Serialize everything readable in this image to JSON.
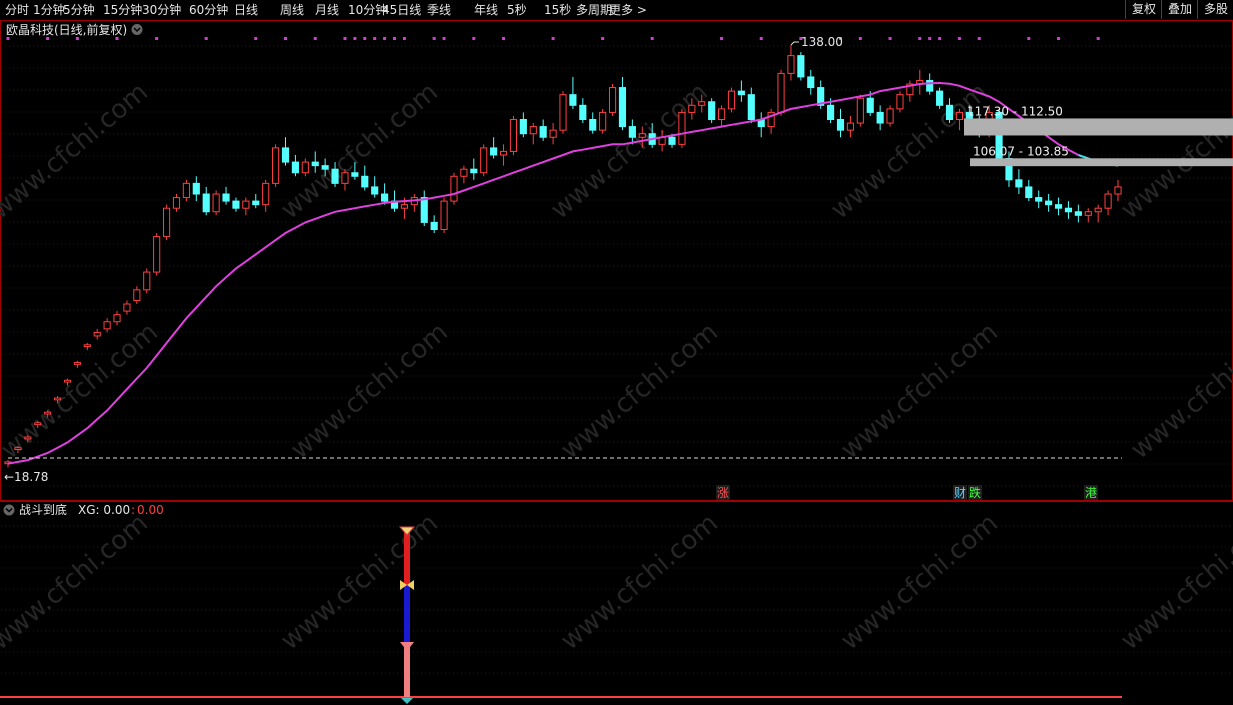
{
  "toolbar": {
    "periods": [
      "分时",
      "1分钟",
      "5分钟",
      "15分钟",
      "30分钟",
      "60分钟",
      "日线",
      "周线",
      "月线",
      "10分钟",
      "45日线",
      "季线",
      "年线",
      "5秒",
      "15秒",
      "多周期",
      "更多 >"
    ],
    "right_buttons": [
      "复权",
      "叠加",
      "多股"
    ]
  },
  "main_panel": {
    "title": "欧晶科技(日线,前复权)",
    "high_label": "138.00",
    "low_label": "18.78",
    "gap_label_1": "117.30 - 112.50",
    "gap_label_2": "106.07 - 103.85",
    "event_markers": [
      {
        "text": "涨",
        "color": "#ff5050"
      },
      {
        "text": "财",
        "color": "#5ad0ff"
      },
      {
        "text": "跌",
        "color": "#40ff40"
      },
      {
        "text": "港",
        "color": "#40ff40"
      }
    ]
  },
  "indicator_panel": {
    "name": "战斗到底",
    "xg_label": "XG: 0.00",
    "xg_value": "0.00"
  },
  "watermark": "www.cfchi.com",
  "colors": {
    "up": "#ff4040",
    "down": "#54ffff",
    "ma": "#e040e0",
    "ma_tail": "#40e0e8",
    "grid": "#5a0000",
    "axis": "#a00000",
    "dots": "#d040d0"
  },
  "chart_data": {
    "type": "candlestick",
    "title": "欧晶科技(日线,前复权)",
    "y_range": [
      18.78,
      138.0
    ],
    "series": [
      {
        "name": "candles",
        "ohlc": [
          [
            20,
            21,
            19,
            20.5
          ],
          [
            24,
            25,
            23,
            24.5
          ],
          [
            27,
            28,
            26,
            27.5
          ],
          [
            31,
            32,
            30,
            31.5
          ],
          [
            34,
            35,
            33,
            34.5
          ],
          [
            38,
            39,
            37,
            38.5
          ],
          [
            43,
            44,
            42,
            43.5
          ],
          [
            48,
            49,
            47,
            48.5
          ],
          [
            53,
            54,
            52,
            53.5
          ],
          [
            56,
            58,
            55,
            57
          ],
          [
            58,
            61,
            57,
            60
          ],
          [
            60,
            63,
            59,
            62
          ],
          [
            63,
            66,
            62,
            65
          ],
          [
            66,
            70,
            65,
            69
          ],
          [
            69,
            75,
            68,
            74
          ],
          [
            74,
            85,
            73,
            84
          ],
          [
            84,
            93,
            83,
            92
          ],
          [
            92,
            96,
            91,
            95
          ],
          [
            95,
            100,
            94,
            99
          ],
          [
            99,
            101,
            94,
            96
          ],
          [
            96,
            98,
            90,
            91
          ],
          [
            91,
            97,
            90,
            96
          ],
          [
            96,
            98,
            93,
            94
          ],
          [
            94,
            95,
            91,
            92
          ],
          [
            92,
            95,
            90,
            94
          ],
          [
            94,
            96,
            92,
            93
          ],
          [
            93,
            100,
            91,
            99
          ],
          [
            99,
            110,
            98,
            109
          ],
          [
            109,
            112,
            104,
            105
          ],
          [
            105,
            107,
            101,
            102
          ],
          [
            102,
            106,
            101,
            105
          ],
          [
            105,
            108,
            102,
            104
          ],
          [
            104,
            106,
            101,
            103
          ],
          [
            103,
            105,
            98,
            99
          ],
          [
            99,
            103,
            97,
            102
          ],
          [
            102,
            105,
            100,
            101
          ],
          [
            101,
            104,
            97,
            98
          ],
          [
            98,
            101,
            95,
            96
          ],
          [
            96,
            99,
            93,
            94
          ],
          [
            94,
            97,
            91,
            92
          ],
          [
            92,
            95,
            89,
            93
          ],
          [
            93,
            96,
            91,
            95
          ],
          [
            95,
            97,
            87,
            88
          ],
          [
            88,
            90,
            85,
            86
          ],
          [
            86,
            95,
            85,
            94
          ],
          [
            94,
            102,
            93,
            101
          ],
          [
            101,
            104,
            99,
            103
          ],
          [
            103,
            106,
            100,
            102
          ],
          [
            102,
            110,
            101,
            109
          ],
          [
            109,
            112,
            106,
            107
          ],
          [
            107,
            110,
            104,
            108
          ],
          [
            108,
            118,
            107,
            117
          ],
          [
            117,
            119,
            112,
            113
          ],
          [
            113,
            116,
            110,
            115
          ],
          [
            115,
            117,
            111,
            112
          ],
          [
            112,
            116,
            110,
            114
          ],
          [
            114,
            125,
            113,
            124
          ],
          [
            124,
            129,
            120,
            121
          ],
          [
            121,
            123,
            116,
            117
          ],
          [
            117,
            119,
            113,
            114
          ],
          [
            114,
            120,
            113,
            119
          ],
          [
            119,
            127,
            118,
            126
          ],
          [
            126,
            129,
            114,
            115
          ],
          [
            115,
            117,
            110,
            112
          ],
          [
            112,
            115,
            109,
            113
          ],
          [
            113,
            116,
            109,
            110
          ],
          [
            110,
            114,
            108,
            112
          ],
          [
            112,
            113,
            109,
            110
          ],
          [
            110,
            120,
            109,
            119
          ],
          [
            119,
            123,
            117,
            121
          ],
          [
            121,
            124,
            119,
            122
          ],
          [
            122,
            123,
            116,
            117
          ],
          [
            117,
            121,
            115,
            120
          ],
          [
            120,
            126,
            119,
            125
          ],
          [
            125,
            128,
            122,
            124
          ],
          [
            124,
            126,
            116,
            117
          ],
          [
            117,
            119,
            112,
            115
          ],
          [
            115,
            120,
            113,
            119
          ],
          [
            119,
            131,
            118,
            130
          ],
          [
            130,
            138,
            128,
            135
          ],
          [
            135,
            136,
            128,
            129
          ],
          [
            129,
            131,
            124,
            126
          ],
          [
            126,
            128,
            120,
            121
          ],
          [
            121,
            123,
            116,
            117
          ],
          [
            117,
            120,
            112,
            114
          ],
          [
            114,
            118,
            112,
            116
          ],
          [
            116,
            124,
            115,
            123
          ],
          [
            123,
            125,
            118,
            119
          ],
          [
            119,
            121,
            114,
            116
          ],
          [
            116,
            121,
            115,
            120
          ],
          [
            120,
            125,
            119,
            124
          ],
          [
            124,
            128,
            122,
            127
          ],
          [
            127,
            131,
            124,
            128
          ],
          [
            128,
            130,
            124,
            125
          ],
          [
            125,
            126,
            120,
            121
          ],
          [
            121,
            123,
            116,
            117
          ],
          [
            117,
            120,
            114,
            119
          ],
          [
            119,
            121,
            115,
            116
          ],
          [
            116,
            118,
            112,
            113
          ],
          [
            113,
            121,
            112,
            119
          ],
          [
            119,
            120,
            104,
            106
          ],
          [
            106,
            108,
            98,
            100
          ],
          [
            100,
            103,
            96,
            98
          ],
          [
            98,
            100,
            94,
            95
          ],
          [
            95,
            97,
            92,
            94
          ],
          [
            94,
            96,
            91,
            93
          ],
          [
            93,
            95,
            90,
            92
          ],
          [
            92,
            94,
            89,
            91
          ],
          [
            91,
            93,
            88,
            90
          ],
          [
            90,
            92,
            88,
            91
          ],
          [
            91,
            93,
            88,
            92
          ],
          [
            92,
            97,
            90,
            96
          ],
          [
            96,
            100,
            94,
            98
          ]
        ]
      },
      {
        "name": "MA",
        "values": [
          20,
          20.5,
          21,
          22,
          23,
          24.5,
          26,
          28,
          30,
          32.5,
          35,
          38,
          41,
          44,
          47,
          50.5,
          54,
          57.5,
          61,
          64,
          67,
          70,
          72.5,
          75,
          77,
          79,
          81,
          83,
          85,
          86.5,
          88,
          89,
          90,
          91,
          91.5,
          92,
          92.5,
          93,
          93.5,
          93.8,
          94,
          94.2,
          94.5,
          95,
          95.5,
          96,
          97,
          98,
          99,
          100,
          101,
          102,
          103,
          104,
          105,
          106,
          107,
          108,
          108.5,
          109,
          109.5,
          110,
          110,
          110.5,
          111,
          111.5,
          112,
          112.5,
          113,
          113.5,
          114,
          114.5,
          115,
          115.5,
          116,
          116.5,
          117,
          118,
          119,
          120,
          120.5,
          121,
          121.5,
          122,
          122.5,
          123,
          123.5,
          124,
          125,
          125.5,
          126,
          126.5,
          127,
          127.2,
          127.3,
          127.1,
          126.5,
          125.5,
          124.5,
          123.5,
          122,
          120,
          118,
          116,
          114,
          112,
          110,
          108.5,
          107,
          106,
          105,
          104.5,
          104
        ]
      }
    ]
  }
}
